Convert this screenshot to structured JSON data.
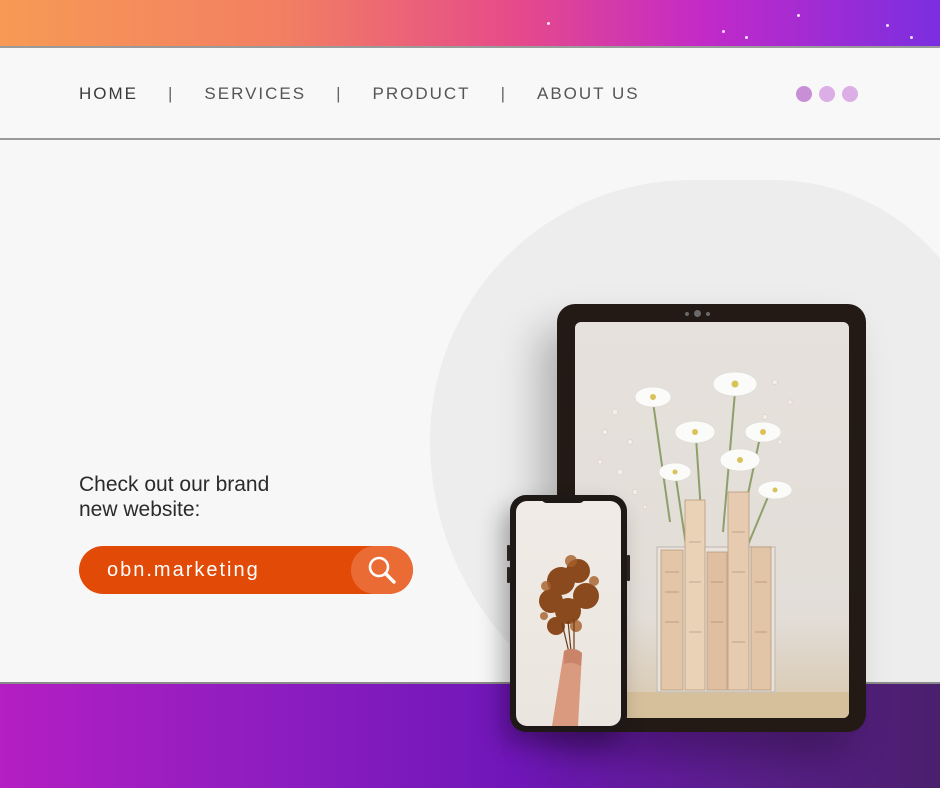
{
  "nav": {
    "items": [
      {
        "label": "HOME",
        "active": true
      },
      {
        "label": "SERVICES",
        "active": false
      },
      {
        "label": "PRODUCT",
        "active": false
      },
      {
        "label": "ABOUT US",
        "active": false
      }
    ],
    "separator": "|",
    "dot_colors": [
      "#c98fd6",
      "#dcaee6",
      "#dcaee6"
    ]
  },
  "hero": {
    "tagline_line1": "Check out our brand",
    "tagline_line2": "new website:",
    "search": {
      "value": "obn.marketing",
      "icon": "search-icon",
      "pill_color": "#e24b07",
      "button_color": "#ea6b34"
    }
  },
  "devices": {
    "tablet_image": "flowers-in-vase-photo",
    "phone_image": "dried-flower-bouquet-photo"
  },
  "colors": {
    "top_gradient": [
      "#f79a55",
      "#e64a8a",
      "#7b2ee0"
    ],
    "bottom_gradient": [
      "#b41ec2",
      "#6f16b8",
      "#4a1f6e"
    ]
  }
}
